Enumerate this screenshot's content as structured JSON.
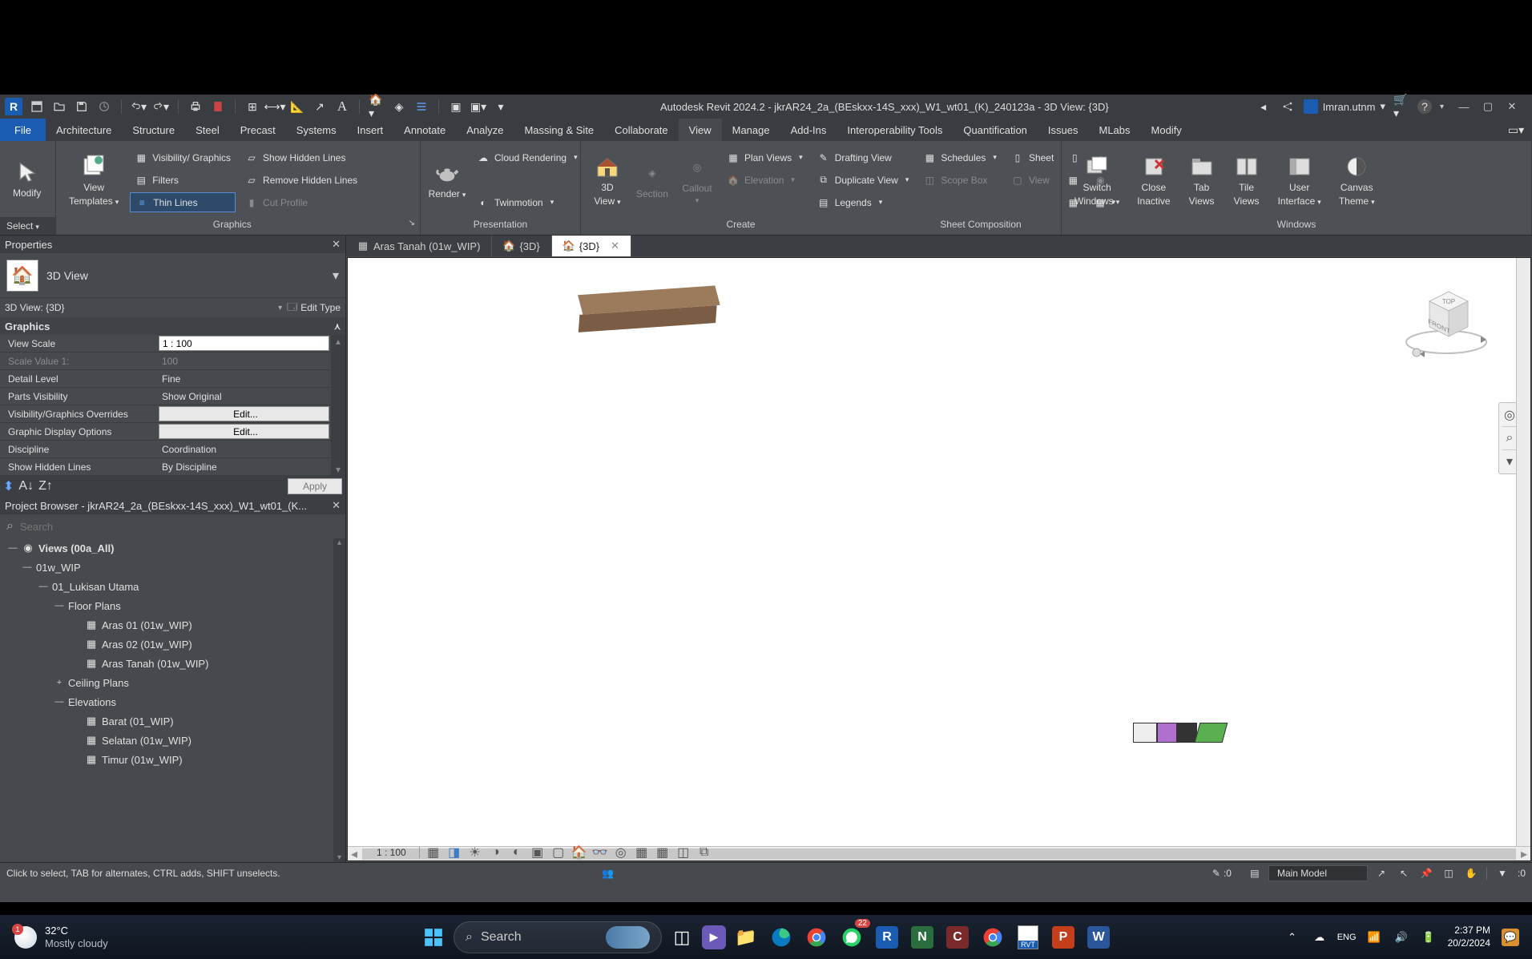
{
  "titlebar": {
    "app_title": "Autodesk Revit 2024.2 - jkrAR24_2a_(BEskxx-14S_xxx)_W1_wt01_(K)_240123a - 3D View: {3D}",
    "user_name": "Imran.utnm"
  },
  "menu": {
    "file": "File",
    "tabs": [
      "Architecture",
      "Structure",
      "Steel",
      "Precast",
      "Systems",
      "Insert",
      "Annotate",
      "Analyze",
      "Massing & Site",
      "Collaborate",
      "View",
      "Manage",
      "Add-Ins",
      "Interoperability Tools",
      "Quantification",
      "Issues",
      "MLabs",
      "Modify"
    ],
    "active": "View"
  },
  "ribbon": {
    "select": "Select",
    "modify": "Modify",
    "view_templates": {
      "l1": "View",
      "l2": "Templates"
    },
    "visibility_graphics": "Visibility/ Graphics",
    "filters": "Filters",
    "thin_lines": "Thin  Lines",
    "show_hidden": "Show  Hidden Lines",
    "remove_hidden": "Remove  Hidden Lines",
    "cut_profile": "Cut  Profile",
    "graphics": "Graphics",
    "render": "Render",
    "cloud_rendering": "Cloud  Rendering",
    "twinmotion": "Twinmotion",
    "presentation": "Presentation",
    "threed": {
      "l1": "3D",
      "l2": "View"
    },
    "section": "Section",
    "callout": "Callout",
    "plan_views": "Plan  Views",
    "elevation": "Elevation",
    "drafting_view": "Drafting  View",
    "duplicate_view": "Duplicate  View",
    "legends": "Legends",
    "schedules": "Schedules",
    "scope_box": "Scope  Box",
    "sheet": "Sheet",
    "view_sm": "View",
    "create": "Create",
    "sheet_composition": "Sheet Composition",
    "switch_windows": {
      "l1": "Switch",
      "l2": "Windows"
    },
    "close_inactive": {
      "l1": "Close",
      "l2": "Inactive"
    },
    "tab_views": {
      "l1": "Tab",
      "l2": "Views"
    },
    "tile_views": {
      "l1": "Tile",
      "l2": "Views"
    },
    "user_interface": {
      "l1": "User",
      "l2": "Interface"
    },
    "canvas_theme": {
      "l1": "Canvas",
      "l2": "Theme"
    },
    "windows": "Windows"
  },
  "properties": {
    "header": "Properties",
    "type_name": "3D View",
    "instance": "3D View: {3D}",
    "edit_type": "Edit Type",
    "group": "Graphics",
    "rows": {
      "view_scale": {
        "n": "View Scale",
        "v": "1 : 100"
      },
      "scale_value": {
        "n": "Scale Value    1:",
        "v": "100"
      },
      "detail_level": {
        "n": "Detail Level",
        "v": "Fine"
      },
      "parts_vis": {
        "n": "Parts Visibility",
        "v": "Show Original"
      },
      "vg_over": {
        "n": "Visibility/Graphics Overrides",
        "v": "Edit..."
      },
      "gdisp": {
        "n": "Graphic Display Options",
        "v": "Edit..."
      },
      "discipline": {
        "n": "Discipline",
        "v": "Coordination"
      },
      "show_hidden": {
        "n": "Show Hidden Lines",
        "v": "By Discipline"
      }
    },
    "apply": "Apply"
  },
  "browser": {
    "header": "Project Browser - jkrAR24_2a_(BEskxx-14S_xxx)_W1_wt01_(K...",
    "search": "Search",
    "views_root": "Views (00a_All)",
    "n01w": "01w_WIP",
    "n01luk": "01_Lukisan Utama",
    "floor_plans": "Floor Plans",
    "aras01": "Aras 01 (01w_WIP)",
    "aras02": "Aras 02 (01w_WIP)",
    "aras_tanah": "Aras Tanah (01w_WIP)",
    "ceiling": "Ceiling Plans",
    "elevations": "Elevations",
    "barat": "Barat (01_WIP)",
    "selatan": "Selatan (01w_WIP)",
    "timur": "Timur (01w_WIP)"
  },
  "viewtabs": {
    "t1": "Aras Tanah (01w_WIP)",
    "t2": "{3D}",
    "t3": "{3D}"
  },
  "canvas": {
    "scale": "1 : 100",
    "viewcube_top": "TOP",
    "viewcube_front": "FRONT"
  },
  "statusbar": {
    "hint": "Click to select, TAB for alternates, CTRL adds, SHIFT unselects.",
    "main_model": "Main Model",
    "sel_count": ":0",
    "filter_count": ":0"
  },
  "taskbar": {
    "temp": "32°C",
    "weather": "Mostly cloudy",
    "badge": "1",
    "search": "Search",
    "time": "2:37 PM",
    "date": "20/2/2024",
    "wa_badge": "22"
  }
}
